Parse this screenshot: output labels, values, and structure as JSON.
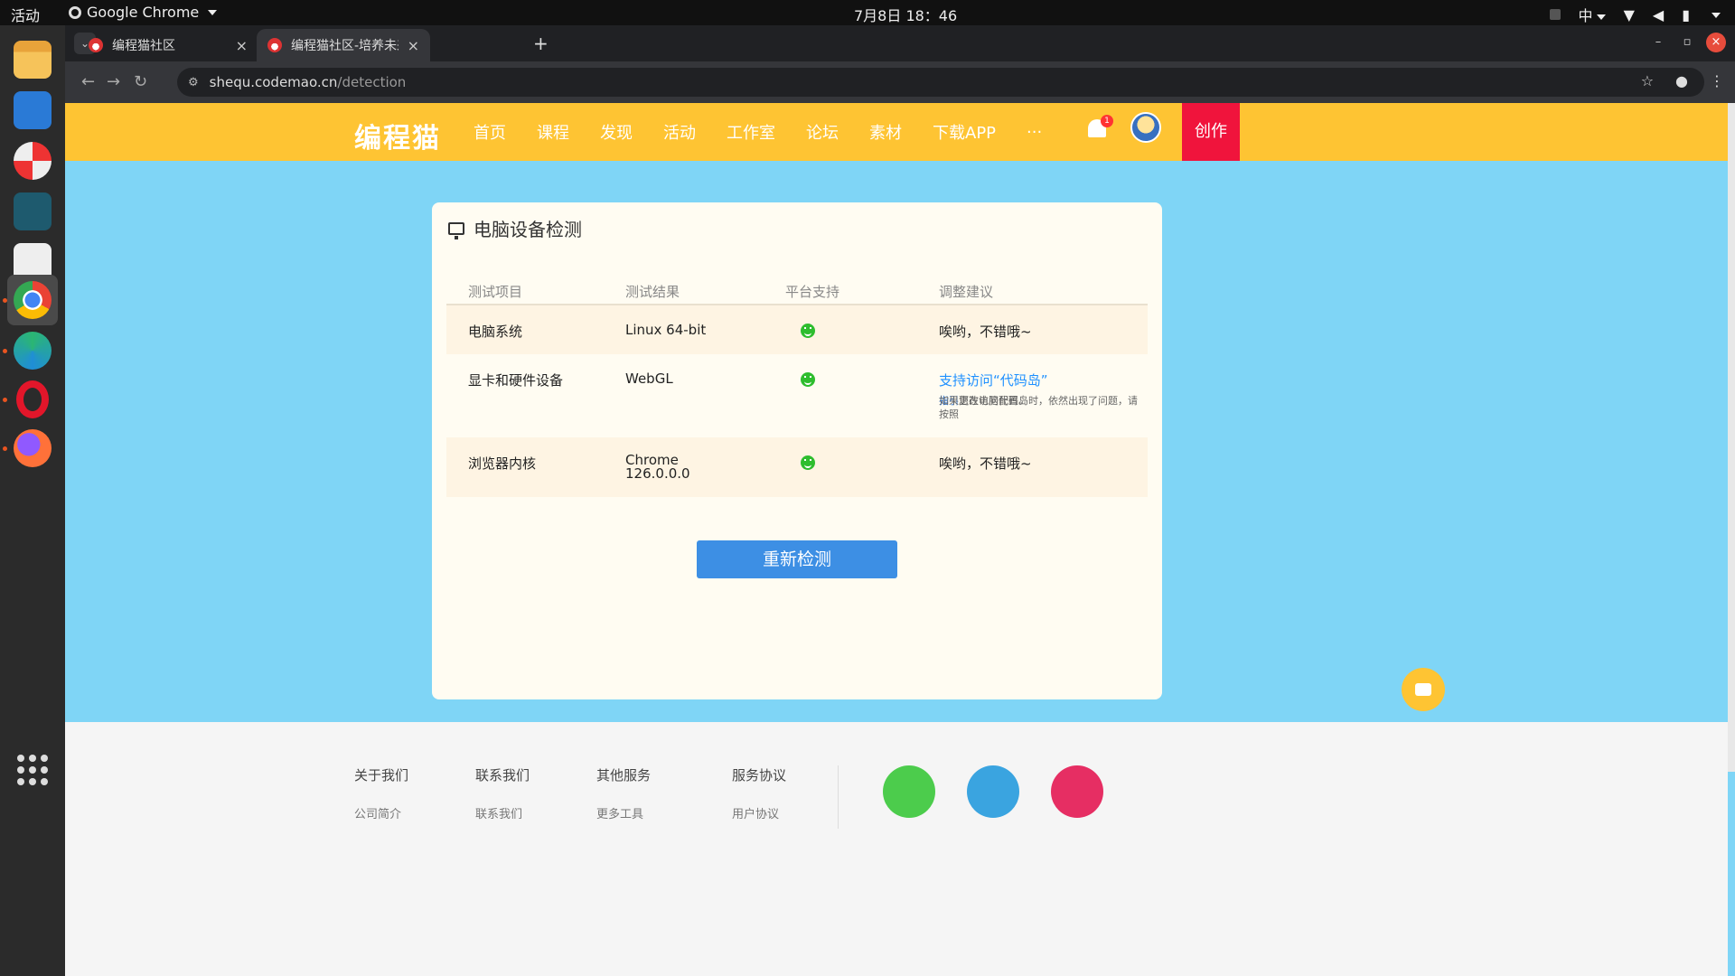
{
  "os": {
    "activities": "活动",
    "app_name": "Google Chrome",
    "clock": "7月8日  18：46",
    "input_method": "中"
  },
  "browser": {
    "tabs": [
      {
        "title": "编程猫社区",
        "active": false
      },
      {
        "title": "编程猫社区-培养未来创作者",
        "active": true
      }
    ],
    "url_host": "shequ.codemao.cn",
    "url_path": "/detection"
  },
  "site": {
    "logo": "编程猫",
    "nav": [
      "首页",
      "课程",
      "发现",
      "活动",
      "工作室",
      "论坛",
      "素材",
      "下载APP",
      "···"
    ],
    "notification_count": "1",
    "create_label": "创作",
    "colors": {
      "header": "#fec433",
      "create": "#f0143c",
      "page_bg": "#7fd5f6",
      "button": "#3d8fe4",
      "ok": "#2ebd2e"
    }
  },
  "detection": {
    "title": "电脑设备检测",
    "columns": [
      "测试项目",
      "测试结果",
      "平台支持",
      "调整建议"
    ],
    "rows": [
      {
        "item": "电脑系统",
        "result": "Linux 64-bit",
        "support": "smile-icon",
        "advice": "唉哟，不错哦~"
      },
      {
        "item": "显卡和硬件设备",
        "result": "WebGL",
        "support": "smile-icon",
        "advice": "支持访问“代码岛”",
        "hint_before": "如果您在访问代码岛时，依然出现了问题，请按照",
        "hint_link": "指引",
        "hint_after": "更改电脑配置。"
      },
      {
        "item": "浏览器内核",
        "result_line1": "Chrome",
        "result_line2": "126.0.0.0",
        "support": "smile-icon",
        "advice": "唉哟，不错哦~"
      }
    ],
    "retry_label": "重新检测"
  },
  "footer": {
    "columns": [
      {
        "heading": "关于我们",
        "first": "公司简介"
      },
      {
        "heading": "联系我们",
        "first": "联系我们"
      },
      {
        "heading": "其他服务",
        "first": "更多工具"
      },
      {
        "heading": "服务协议",
        "first": "用户协议"
      }
    ],
    "social": [
      "wechat-icon",
      "qq-icon",
      "weibo-icon"
    ]
  }
}
